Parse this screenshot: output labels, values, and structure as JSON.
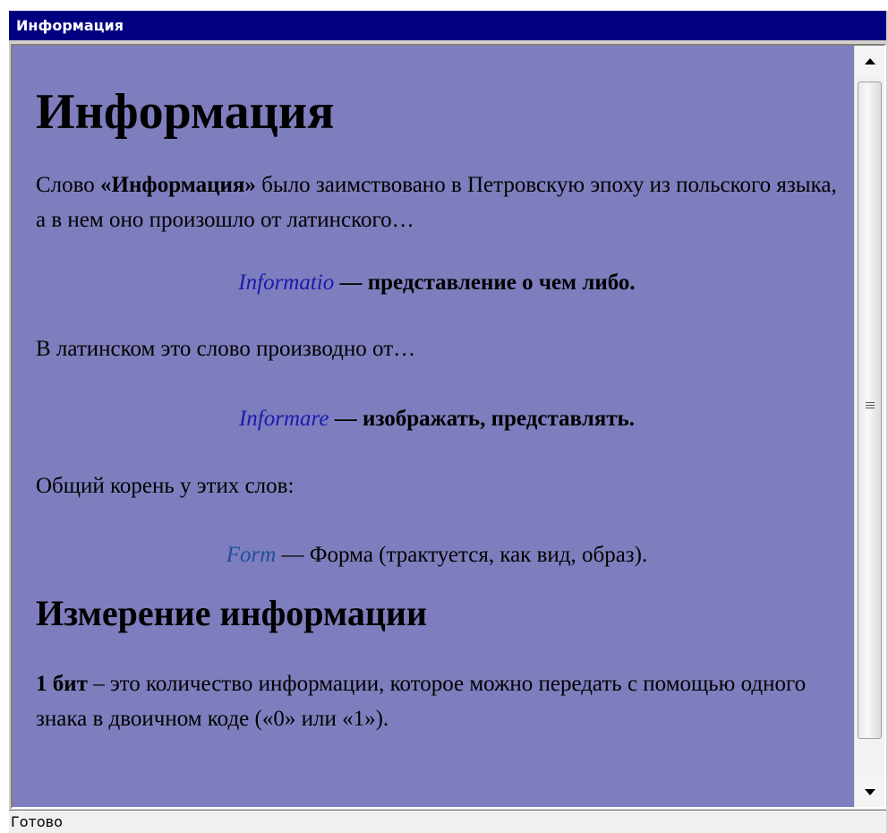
{
  "window": {
    "title": "Информация"
  },
  "article": {
    "heading": "Информация",
    "para1": {
      "prefix": "Слово ",
      "bold": "«Информация»",
      "suffix": " было заимствовано в Петровскую эпоху из польского языка, а в нем оно произошло от латинского…"
    },
    "definition1": {
      "latin": "Informatio",
      "dash": " — ",
      "meaning": "представление о чем либо."
    },
    "para2": "В латинском это слово производно от…",
    "definition2": {
      "latin": "Informare",
      "dash": " — ",
      "meaning": "изображать, представлять."
    },
    "para3": "Общий корень у этих слов:",
    "definition3": {
      "latin": "Form",
      "rest": " — Форма (трактуется, как вид, образ)."
    },
    "subheading": "Измерение информации",
    "para4": {
      "bold": "1 бит",
      "rest": " – это количество информации, которое можно передать с помощью одного знака в двоичном коде («0» или «1»)."
    }
  },
  "statusbar": {
    "text": "Готово"
  },
  "colors": {
    "titlebar": "#000080",
    "content_background": "#7e7ebe",
    "latin_link": "#1a1ab0"
  },
  "icons": {
    "scroll_up": "arrow-up-icon",
    "scroll_down": "arrow-down-icon",
    "thumb_grip": "grip-icon"
  }
}
